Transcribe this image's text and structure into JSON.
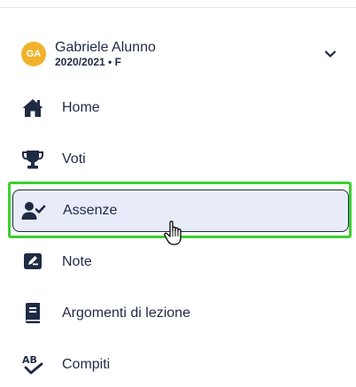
{
  "profile": {
    "initials": "GA",
    "name": "Gabriele Alunno",
    "subtitle": "2020/2021 • F",
    "avatar_color": "#f0b22c",
    "chevron_icon": "chevron-down-icon"
  },
  "nav": {
    "items": [
      {
        "label": "Home",
        "icon": "home-icon"
      },
      {
        "label": "Voti",
        "icon": "trophy-icon"
      },
      {
        "label": "Assenze",
        "icon": "user-check-icon",
        "active": true
      },
      {
        "label": "Note",
        "icon": "note-icon"
      },
      {
        "label": "Argomenti di lezione",
        "icon": "book-icon"
      },
      {
        "label": "Compiti",
        "icon": "ab-check-icon"
      }
    ]
  },
  "colors": {
    "text": "#1f2a44",
    "active_bg": "#e8ebf8",
    "highlight": "#3bd12f"
  }
}
